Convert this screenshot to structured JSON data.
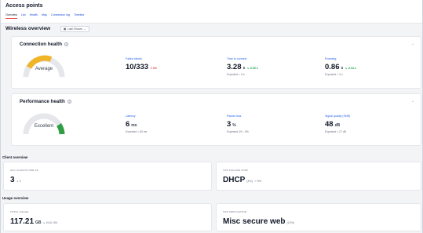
{
  "header": {
    "title": "Access points",
    "tabs": [
      "Overview",
      "List",
      "Health",
      "Map",
      "Connection log",
      "Timeline"
    ]
  },
  "wireless_overview": {
    "title": "Wireless overview",
    "range_label": "Last 3 hours",
    "range_icon": "calendar-icon"
  },
  "connection_health": {
    "title": "Connection health",
    "gauge_label": "Average",
    "gauge_color": "#f0b429",
    "metrics": [
      {
        "label": "Failed clients",
        "value": "10/333",
        "unit": "",
        "delta": "↗ 1%",
        "delta_tone": "red",
        "expected": ""
      },
      {
        "label": "Time to connect",
        "value": "3.28",
        "unit": "s",
        "delta": "↘ -0.05 s",
        "delta_tone": "green",
        "expected": "Expected < 5 s"
      },
      {
        "label": "Roaming",
        "value": "0.86",
        "unit": "s",
        "delta": "↘ -0.04 s",
        "delta_tone": "green",
        "expected": "Expected < 3 s"
      }
    ]
  },
  "performance_health": {
    "title": "Performance health",
    "gauge_label": "Excellent",
    "gauge_color": "#2f9e44",
    "metrics": [
      {
        "label": "Latency",
        "value": "6",
        "unit": "ms",
        "delta": "",
        "delta_tone": "",
        "expected": "Expected < 60 ms"
      },
      {
        "label": "Packet loss",
        "value": "3",
        "unit": "%",
        "delta": "",
        "delta_tone": "",
        "expected": "Expected 2% - 5%"
      },
      {
        "label": "Signal quality (SNR)",
        "value": "48",
        "unit": "dB",
        "delta": "",
        "delta_tone": "",
        "expected": "Expected > 27 dB"
      }
    ]
  },
  "client_overview": {
    "title": "Client overview",
    "avg_clients": {
      "label": "AVG CLIENTS PER AP",
      "value": "3",
      "delta": "↘ 4"
    },
    "top_failure": {
      "label": "TOP FAILURE STEP",
      "value": "DHCP",
      "percent": "(4%)",
      "delta": "↗ 5%"
    }
  },
  "usage_overview": {
    "title": "Usage overview",
    "total_usage": {
      "label": "TOTAL USAGE",
      "value": "117.21",
      "unit": "GB",
      "delta": "↘ 19.81 GB"
    },
    "top_application": {
      "label": "TOP APPLICATION",
      "value": "Misc secure web",
      "percent": "(12%)"
    }
  }
}
